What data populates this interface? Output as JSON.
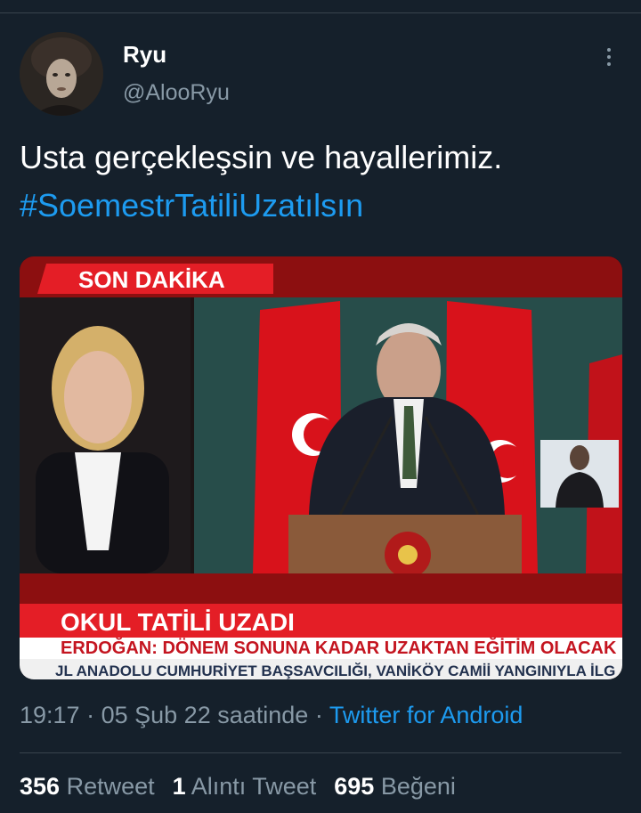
{
  "user": {
    "display_name": "Ryu",
    "handle": "@AlooRyu"
  },
  "tweet": {
    "text": "Usta gerçekleşsin ve hayallerimiz.",
    "hashtag": "#SoemestrTatiliUzatılsın"
  },
  "media": {
    "breaking_label": "SON DAKİKA",
    "headline": "OKUL TATİLİ UZADI",
    "subheadline": "ERDOĞAN: DÖNEM SONUNA KADAR UZAKTAN EĞİTİM OLACAK",
    "ticker": "JL ANADOLU CUMHURİYET BAŞSAVCILIĞI, VANİKÖY CAMİİ YANGINIYLA İLG"
  },
  "meta": {
    "time": "19:17",
    "separator": "·",
    "date": "05 Şub 22 saatinde",
    "source": "Twitter for Android"
  },
  "stats": {
    "retweets_count": "356",
    "retweets_label": "Retweet",
    "quotes_count": "1",
    "quotes_label": "Alıntı Tweet",
    "likes_count": "695",
    "likes_label": "Beğeni"
  },
  "colors": {
    "background": "#15202b",
    "accent": "#1d9bf0",
    "secondary_text": "#8899a6",
    "breaking_red": "#d71920"
  }
}
